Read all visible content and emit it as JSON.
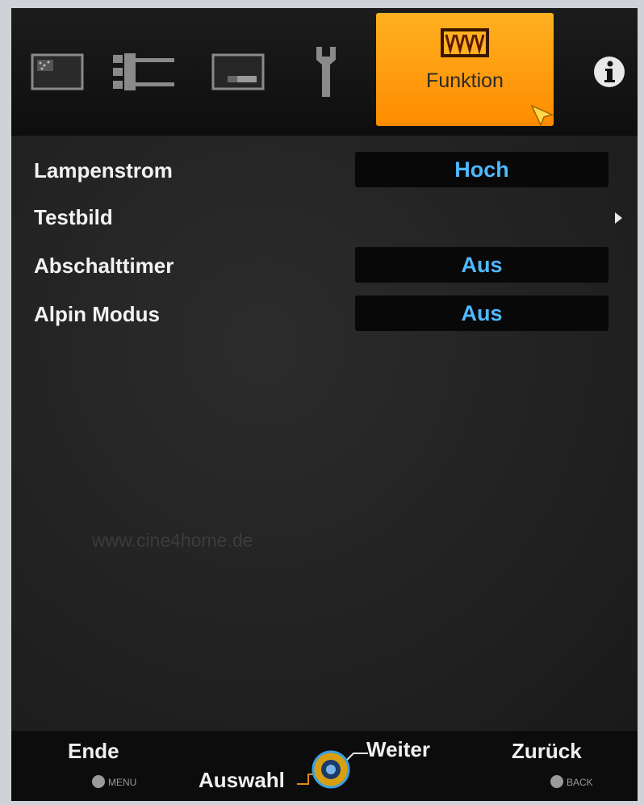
{
  "tabs": [
    {
      "id": "picture",
      "icon": "picture-icon"
    },
    {
      "id": "setup",
      "icon": "connector-icon"
    },
    {
      "id": "display",
      "icon": "display-icon"
    },
    {
      "id": "installation",
      "icon": "wrench-icon"
    },
    {
      "id": "function",
      "icon": "function-icon",
      "label": "Funktion",
      "active": true
    },
    {
      "id": "info",
      "icon": "info-icon"
    }
  ],
  "menu": {
    "items": [
      {
        "label": "Lampenstrom",
        "value": "Hoch"
      },
      {
        "label": "Testbild",
        "value": "",
        "submenu_arrow": "▶"
      },
      {
        "label": "Abschalttimer",
        "value": "Aus"
      },
      {
        "label": "Alpin Modus",
        "value": "Aus"
      }
    ]
  },
  "watermark": "www.cine4home.de",
  "footer": {
    "ende": {
      "label": "Ende",
      "key": "MENU"
    },
    "auswahl": {
      "label": "Auswahl"
    },
    "weiter": {
      "label": "Weiter"
    },
    "zurueck": {
      "label": "Zurück",
      "key": "BACK"
    }
  },
  "colors": {
    "active_tab": "#ff9a10",
    "value_text": "#4fb8ff",
    "background": "#1f1f1f"
  }
}
